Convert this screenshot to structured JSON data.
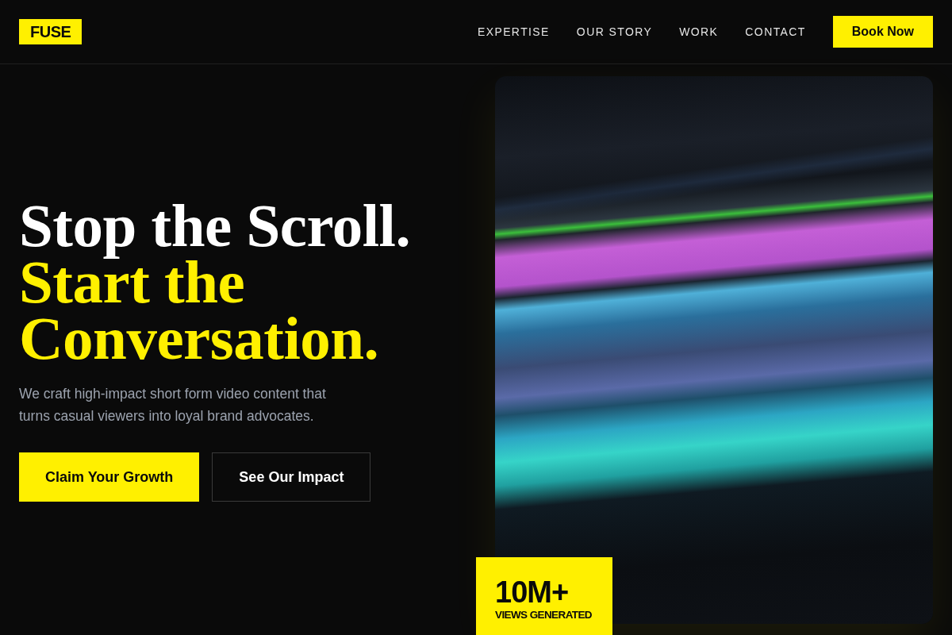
{
  "logo": {
    "text": "FUSE"
  },
  "nav": {
    "links": [
      {
        "label": "EXPERTISE"
      },
      {
        "label": "OUR STORY"
      },
      {
        "label": "WORK"
      },
      {
        "label": "CONTACT"
      }
    ],
    "cta": "Book Now"
  },
  "hero": {
    "headline": [
      {
        "text": "Stop the Scroll.",
        "highlight": false
      },
      {
        "text": "Start the Conversation.",
        "highlight": true
      }
    ],
    "description": "We craft high-impact short form video content that turns casual viewers into loyal brand advocates.",
    "buttons": [
      {
        "label": "Claim Your Growth",
        "kind": "primary"
      },
      {
        "label": "See Our Impact",
        "kind": "outline"
      }
    ]
  },
  "stat": {
    "value": "10M+",
    "label": "VIEWS GENERATED"
  }
}
